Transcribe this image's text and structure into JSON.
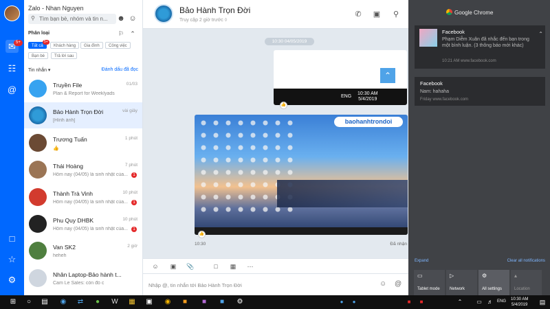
{
  "sidebar": {
    "badge": "5+"
  },
  "list": {
    "title": "Zalo - Nhan Nguyen",
    "search_placeholder": "Tìm bạn bè, nhóm và tin n...",
    "section": "Phân loại",
    "chips": [
      "Tất cả",
      "Khách hàng",
      "Gia đình",
      "Công việc",
      "Bạn bè",
      "Trả lời sau"
    ],
    "chip_badge": "5+",
    "messages_tab": "Tin nhắn",
    "mark_read": "Đánh dấu đã đọc",
    "conversations": [
      {
        "name": "Truyền File",
        "preview": "Plan & Report for Weeklyads",
        "time": "01/03",
        "unread": ""
      },
      {
        "name": "Bảo Hành Trọn Đời",
        "preview": "[Hình ảnh]",
        "time": "vài giây",
        "unread": ""
      },
      {
        "name": "Trương Tuấn",
        "preview": "👍",
        "time": "1 phút",
        "unread": ""
      },
      {
        "name": "Thái Hoàng",
        "preview": "Hôm nay (04/05) là sinh nhật của...",
        "time": "7 phút",
        "unread": "1"
      },
      {
        "name": "Thành Trà Vinh",
        "preview": "Hôm nay (04/05) là sinh nhật của...",
        "time": "10 phút",
        "unread": "1"
      },
      {
        "name": "Phu Quy DHBK",
        "preview": "Hôm nay (04/05) là sinh nhật của...",
        "time": "10 phút",
        "unread": "1"
      },
      {
        "name": "Van SK2",
        "preview": "heheh",
        "time": "2 giờ",
        "unread": ""
      },
      {
        "name": "Nhân Laptop-Bảo hành t...",
        "preview": "Cam Le Sales: còn đó c",
        "time": "",
        "unread": ""
      }
    ]
  },
  "chat": {
    "name": "Bảo Hành Trọn Đời",
    "status": "Truy cập 2 giờ trước",
    "date_pill": "10:30 04/05/2019",
    "img1_lang": "ENG",
    "img1_time": "10:30 AM",
    "img1_date": "5/4/2019",
    "img2_brand": "baohanhtrondoi",
    "msg_time": "10:30",
    "msg_status": "Đã nhận",
    "composer_placeholder": "Nhập @, tin nhắn tới Bảo Hành Trọn Đời"
  },
  "action_center": {
    "app": "Google Chrome",
    "notifications": [
      {
        "title": "Facebook",
        "body": "Phạm Diễm Xuân  đã nhắc đến bạn trong một bình luận. (3 thông báo mới khác)",
        "source": "10:21 AM www.facebook.com"
      },
      {
        "title": "Facebook",
        "body": "Nam: hahaha",
        "source": "Friday  www.facebook.com"
      }
    ],
    "expand": "Expand",
    "clear_all": "Clear all notifications",
    "quick_actions": [
      "Tablet mode",
      "Network",
      "All settings",
      "Location"
    ]
  },
  "taskbar": {
    "lang": "ENG",
    "time": "10:30 AM",
    "date": "5/4/2019"
  },
  "colors": {
    "brand": "#0068ff",
    "badge": "#e4292a"
  }
}
